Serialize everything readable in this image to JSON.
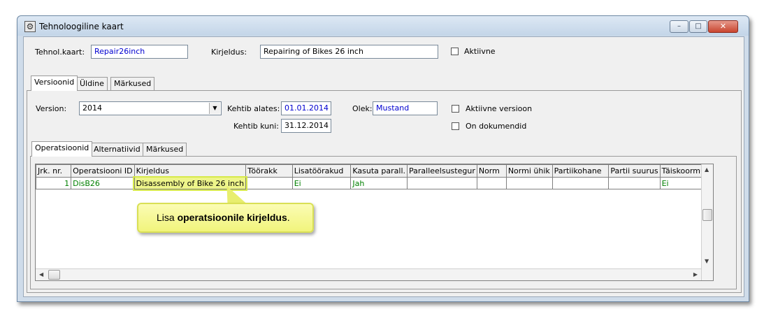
{
  "window": {
    "title": "Tehnoloogiline kaart",
    "min_label": "–",
    "max_label": "□",
    "close_label": "✕"
  },
  "header": {
    "tehnol_label": "Tehnol.kaart:",
    "tehnol_value": "Repair26inch",
    "kirjeldus_label": "Kirjeldus:",
    "kirjeldus_value": "Repairing of Bikes 26 inch",
    "aktiivne_label": "Aktiivne"
  },
  "main_tabs": [
    "Versioonid",
    "Üldine",
    "Märkused"
  ],
  "version": {
    "version_label": "Version:",
    "version_value": "2014",
    "kehtib_alates_label": "Kehtib alates:",
    "kehtib_alates_value": "01.01.2014",
    "kehtib_kuni_label": "Kehtib kuni:",
    "kehtib_kuni_value": "31.12.2014",
    "olek_label": "Olek:",
    "olek_value": "Mustand",
    "aktiivne_versioon_label": "Aktiivne versioon",
    "on_dokumendid_label": "On dokumendid"
  },
  "sub_tabs": [
    "Operatsioonid",
    "Alternatiivid",
    "Märkused"
  ],
  "table": {
    "columns": [
      "Jrk. nr.",
      "Operatsiooni ID",
      "Kirjeldus",
      "Töörakk",
      "Lisatöörakud",
      "Kasuta parall.",
      "Paralleelsustegur",
      "Norm",
      "Normi ühik",
      "Partiikohane",
      "Partii suurus",
      "Täiskoormus"
    ],
    "rows": [
      [
        "1",
        "DisB26",
        "Disassembly of Bike 26 inch",
        "",
        "Ei",
        "Jah",
        "",
        "",
        "",
        "",
        "",
        "Ei"
      ]
    ]
  },
  "callout": {
    "prefix": "Lisa ",
    "bold": "operatsioonile kirjeldus",
    "suffix": "."
  },
  "icons": {
    "app": "app-icon",
    "dropdown": "chevron-down-icon"
  }
}
